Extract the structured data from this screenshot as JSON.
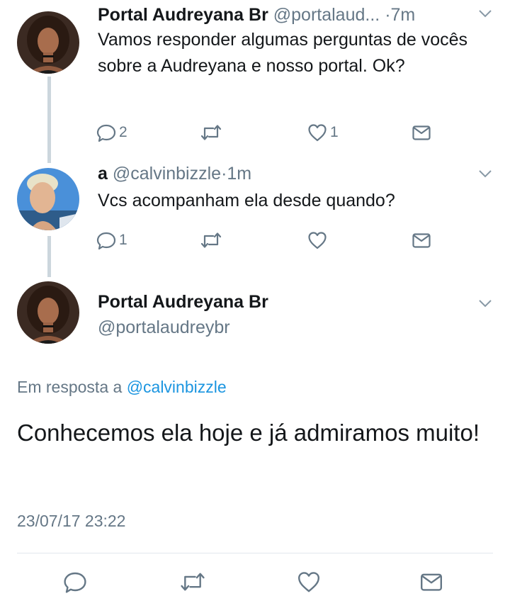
{
  "colors": {
    "text": "#14171a",
    "muted": "#657786",
    "link": "#1b95e0",
    "thread_line": "#ccd6dd",
    "icon": "#657786"
  },
  "tweets": [
    {
      "name": "Portal Audreyana Br",
      "handle": "@portalaud...",
      "time": "7m",
      "text": "Vamos responder algumas perguntas de vocês sobre a Audreyana e nosso portal. Ok?",
      "reply_count": "2",
      "like_count": "1",
      "icons": [
        "reply-icon",
        "retweet-icon",
        "like-icon",
        "dm-icon"
      ]
    },
    {
      "name": "a",
      "handle": "@calvinbizzle",
      "time": "1m",
      "text": "Vcs acompanham ela desde quando?",
      "reply_count": "1",
      "icons": [
        "reply-icon",
        "retweet-icon",
        "like-icon",
        "dm-icon"
      ]
    }
  ],
  "main_tweet": {
    "name": "Portal Audreyana Br",
    "handle": "@portalaudreybr",
    "reply_prefix": "Em resposta a",
    "reply_handle": "@calvinbizzle",
    "text": "Conhecemos ela hoje e já admiramos muito!",
    "timestamp": "23/07/17 23:22",
    "icons": [
      "reply-icon",
      "retweet-icon",
      "like-icon",
      "dm-icon"
    ]
  },
  "separator": "·"
}
